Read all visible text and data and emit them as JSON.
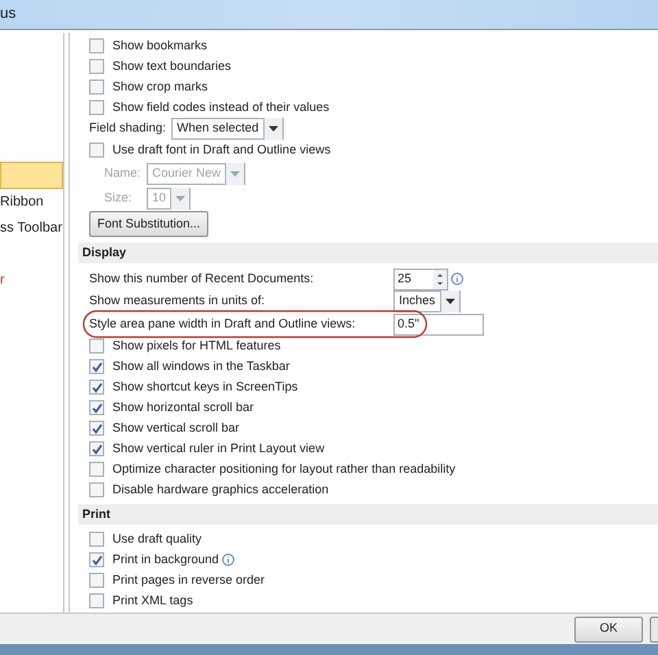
{
  "window": {
    "title": "us"
  },
  "sidebar": {
    "items": [
      {
        "selected": true
      },
      {
        "label": "Ribbon",
        "selected": false
      },
      {
        "label": "ss Toolbar",
        "selected": false
      },
      {
        "label": "r",
        "selected": false,
        "color": "#c0392b"
      }
    ]
  },
  "sections": [
    {
      "items": [
        {
          "kind": "checkbox",
          "label": "Show bookmarks",
          "checked": false
        },
        {
          "kind": "checkbox",
          "label": "Show text boundaries",
          "checked": false
        },
        {
          "kind": "checkbox",
          "label": "Show crop marks",
          "checked": false
        },
        {
          "kind": "checkbox",
          "label": "Show field codes instead of their values",
          "checked": false
        },
        {
          "kind": "dropdown",
          "label": "Field shading:",
          "value": "When selected",
          "disabled": false
        },
        {
          "kind": "checkbox",
          "label": "Use draft font in Draft and Outline views",
          "checked": false
        },
        {
          "kind": "subdropdown",
          "label": "Name:",
          "value": "Courier New",
          "disabled": true
        },
        {
          "kind": "subdropdown",
          "label": "Size:",
          "value": "10",
          "disabled": true
        },
        {
          "kind": "button",
          "label": "Font Substitution..."
        }
      ]
    },
    {
      "title": "Display",
      "items": [
        {
          "kind": "spin",
          "label": "Show this number of Recent Documents:",
          "value": "25",
          "info": true
        },
        {
          "kind": "dropdown",
          "label": "Show measurements in units of:",
          "value": "Inches",
          "disabled": false
        },
        {
          "kind": "text",
          "label": "Style area pane width in Draft and Outline views:",
          "value": "0.5\"",
          "highlighted": true
        },
        {
          "kind": "checkbox",
          "label": "Show pixels for HTML features",
          "checked": false
        },
        {
          "kind": "checkbox",
          "label": "Show all windows in the Taskbar",
          "checked": true
        },
        {
          "kind": "checkbox",
          "label": "Show shortcut keys in ScreenTips",
          "checked": true
        },
        {
          "kind": "checkbox",
          "label": "Show horizontal scroll bar",
          "checked": true
        },
        {
          "kind": "checkbox",
          "label": "Show vertical scroll bar",
          "checked": true
        },
        {
          "kind": "checkbox",
          "label": "Show vertical ruler in Print Layout view",
          "checked": true
        },
        {
          "kind": "checkbox",
          "label": "Optimize character positioning for layout rather than readability",
          "checked": false
        },
        {
          "kind": "checkbox",
          "label": "Disable hardware graphics acceleration",
          "checked": false
        }
      ]
    },
    {
      "title": "Print",
      "items": [
        {
          "kind": "checkbox",
          "label": "Use draft quality",
          "checked": false
        },
        {
          "kind": "checkbox",
          "label": "Print in background",
          "checked": true,
          "info": true
        },
        {
          "kind": "checkbox",
          "label": "Print pages in reverse order",
          "checked": false
        },
        {
          "kind": "checkbox",
          "label": "Print XML tags",
          "checked": false
        }
      ]
    }
  ],
  "buttons": [
    "OK"
  ]
}
